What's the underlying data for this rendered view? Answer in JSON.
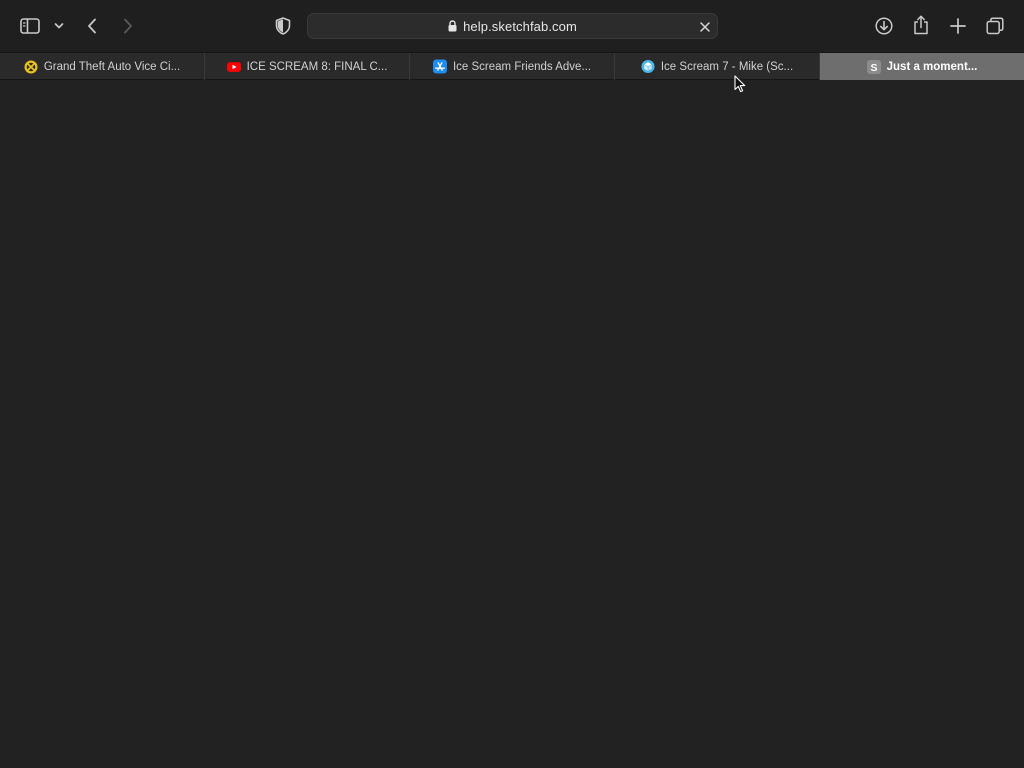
{
  "browser": {
    "address_bar": {
      "url": "help.sketchfab.com"
    },
    "toolbar_icons": {
      "sidebar": "sidebar-icon",
      "sidebar_menu": "chevron-down-icon",
      "back": "chevron-left-icon",
      "forward": "chevron-right-icon",
      "privacy": "shield-icon",
      "lock": "lock-icon",
      "clear": "close-icon",
      "downloads": "download-icon",
      "share": "share-icon",
      "new_tab": "plus-icon",
      "tab_overview": "tab-overview-icon"
    }
  },
  "tabs": [
    {
      "title": "Grand Theft Auto Vice Ci...",
      "favicon": "gta-favicon",
      "active": false
    },
    {
      "title": "ICE SCREAM 8: FINAL C...",
      "favicon": "youtube-favicon",
      "active": false
    },
    {
      "title": "Ice Scream Friends Adve...",
      "favicon": "app-store-favicon",
      "active": false
    },
    {
      "title": "Ice Scream 7 - Mike (Sc...",
      "favicon": "sketchfab-favicon",
      "active": false
    },
    {
      "title": "Just a moment...",
      "favicon": "S",
      "active": true
    }
  ],
  "colors": {
    "page_background": "#222222",
    "toolbar_background": "#1f1f1f",
    "tabbar_background": "#2a2a2a",
    "active_tab": "#6e6e6e",
    "youtube_red": "#ff0000",
    "app_store_blue": "#1e8cf0",
    "gta_yellow": "#e8c21a",
    "sketchfab_blue": "#4bb6e6"
  }
}
